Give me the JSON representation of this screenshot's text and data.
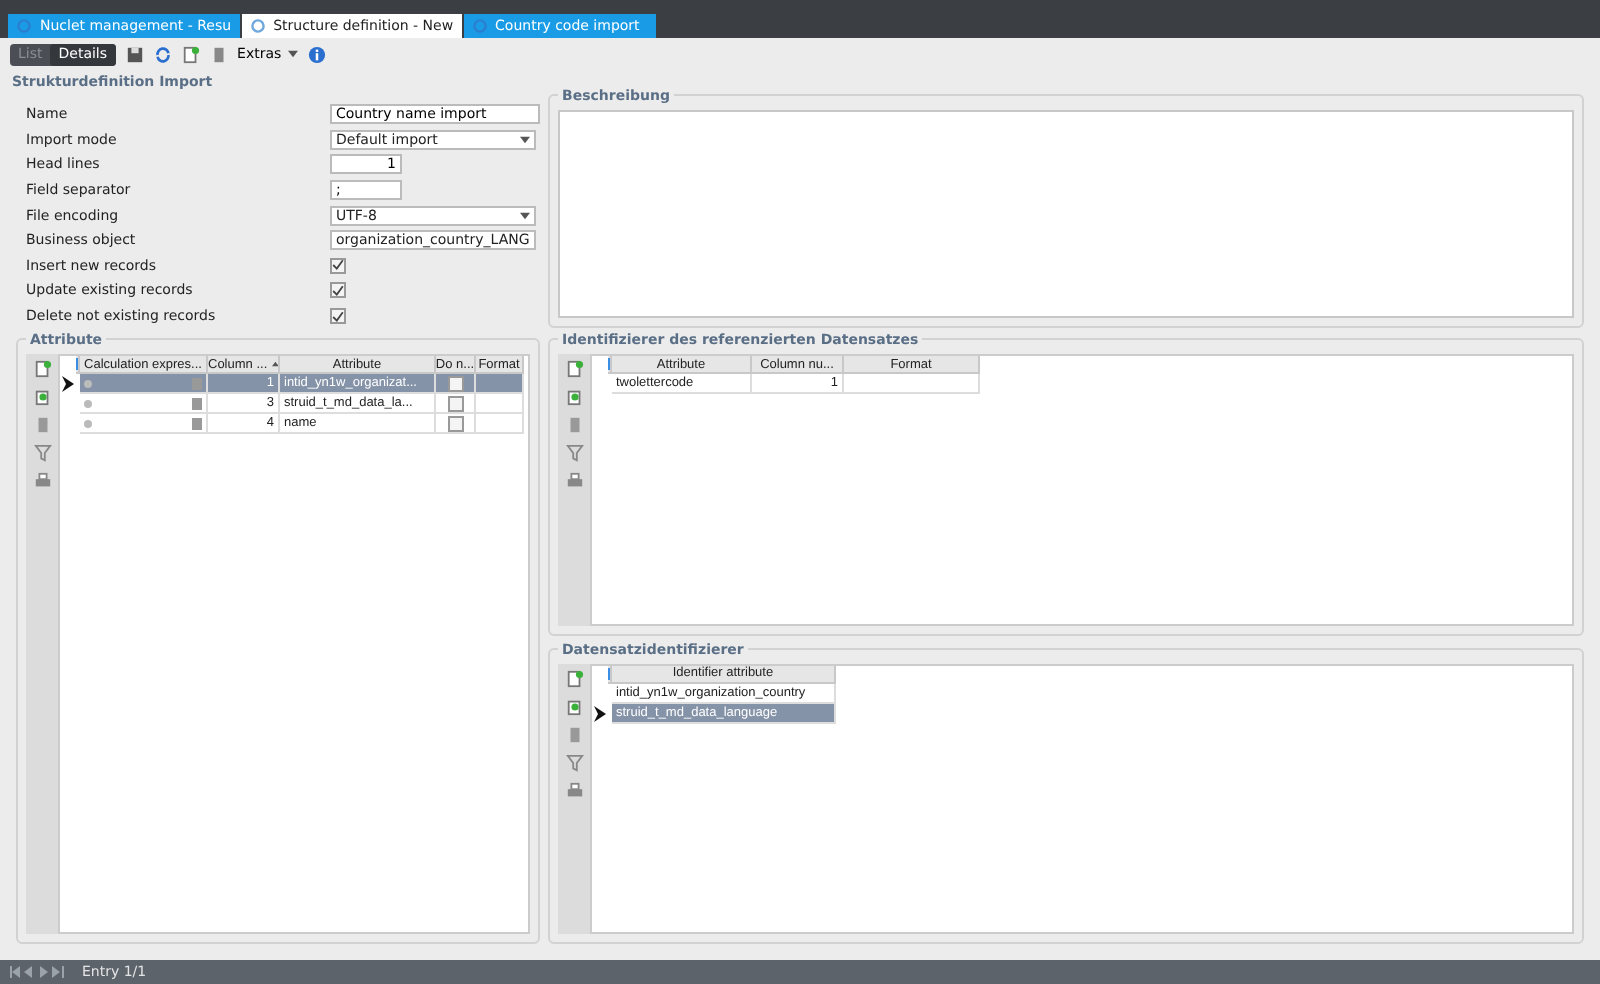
{
  "tabs": [
    {
      "label": "Nuclet management - Resu",
      "selected": false
    },
    {
      "label": "Structure definition  - New",
      "selected": true
    },
    {
      "label": "Country code import",
      "selected": false
    }
  ],
  "toolbar": {
    "view_toggle": [
      {
        "label": "List",
        "selected": false
      },
      {
        "label": "Details",
        "selected": true
      }
    ],
    "extras_label": "Extras"
  },
  "section_title": "Strukturdefinition Import",
  "form_fields": [
    {
      "kind": "text",
      "label": "Name",
      "value": "Country name import"
    },
    {
      "kind": "select",
      "label": "Import mode",
      "value": "Default import"
    },
    {
      "kind": "number",
      "label": "Head lines",
      "value": "1"
    },
    {
      "kind": "short",
      "label": "Field separator",
      "value": ";"
    },
    {
      "kind": "select",
      "label": "File encoding",
      "value": "UTF-8"
    },
    {
      "kind": "select",
      "label": "Business object",
      "value": "organization_country_LANG"
    },
    {
      "kind": "checkbox",
      "label": "Insert new records",
      "checked": true
    },
    {
      "kind": "checkbox",
      "label": "Update existing records",
      "checked": true
    },
    {
      "kind": "checkbox",
      "label": "Delete not existing records",
      "checked": true
    }
  ],
  "description_panel": {
    "title": "Beschreibung"
  },
  "attribute_panel": {
    "title": "Attribute",
    "columns": [
      "Calculation expres...",
      "Column ...",
      "Attribute",
      "Do n...",
      "Format"
    ],
    "rows": [
      {
        "selected": true,
        "column": "1",
        "attribute": "intid_yn1w_organizat...",
        "do_not": false
      },
      {
        "selected": false,
        "column": "3",
        "attribute": "struid_t_md_data_la...",
        "do_not": false
      },
      {
        "selected": false,
        "column": "4",
        "attribute": "name",
        "do_not": false
      }
    ]
  },
  "reference_panel": {
    "title": "Identifizierer des referenzierten Datensatzes",
    "columns": [
      "Attribute",
      "Column nu...",
      "Format"
    ],
    "rows": [
      {
        "selected": false,
        "cells": [
          "twolettercode",
          "1",
          ""
        ]
      }
    ]
  },
  "identifier_panel": {
    "title": "Datensatzidentifizierer",
    "columns": [
      "Identifier attribute"
    ],
    "rows": [
      {
        "selected": false,
        "cells": [
          "intid_yn1w_organization_country"
        ]
      },
      {
        "selected": true,
        "cells": [
          "struid_t_md_data_language"
        ]
      }
    ]
  },
  "status_bar": {
    "text": "Entry 1/1"
  }
}
